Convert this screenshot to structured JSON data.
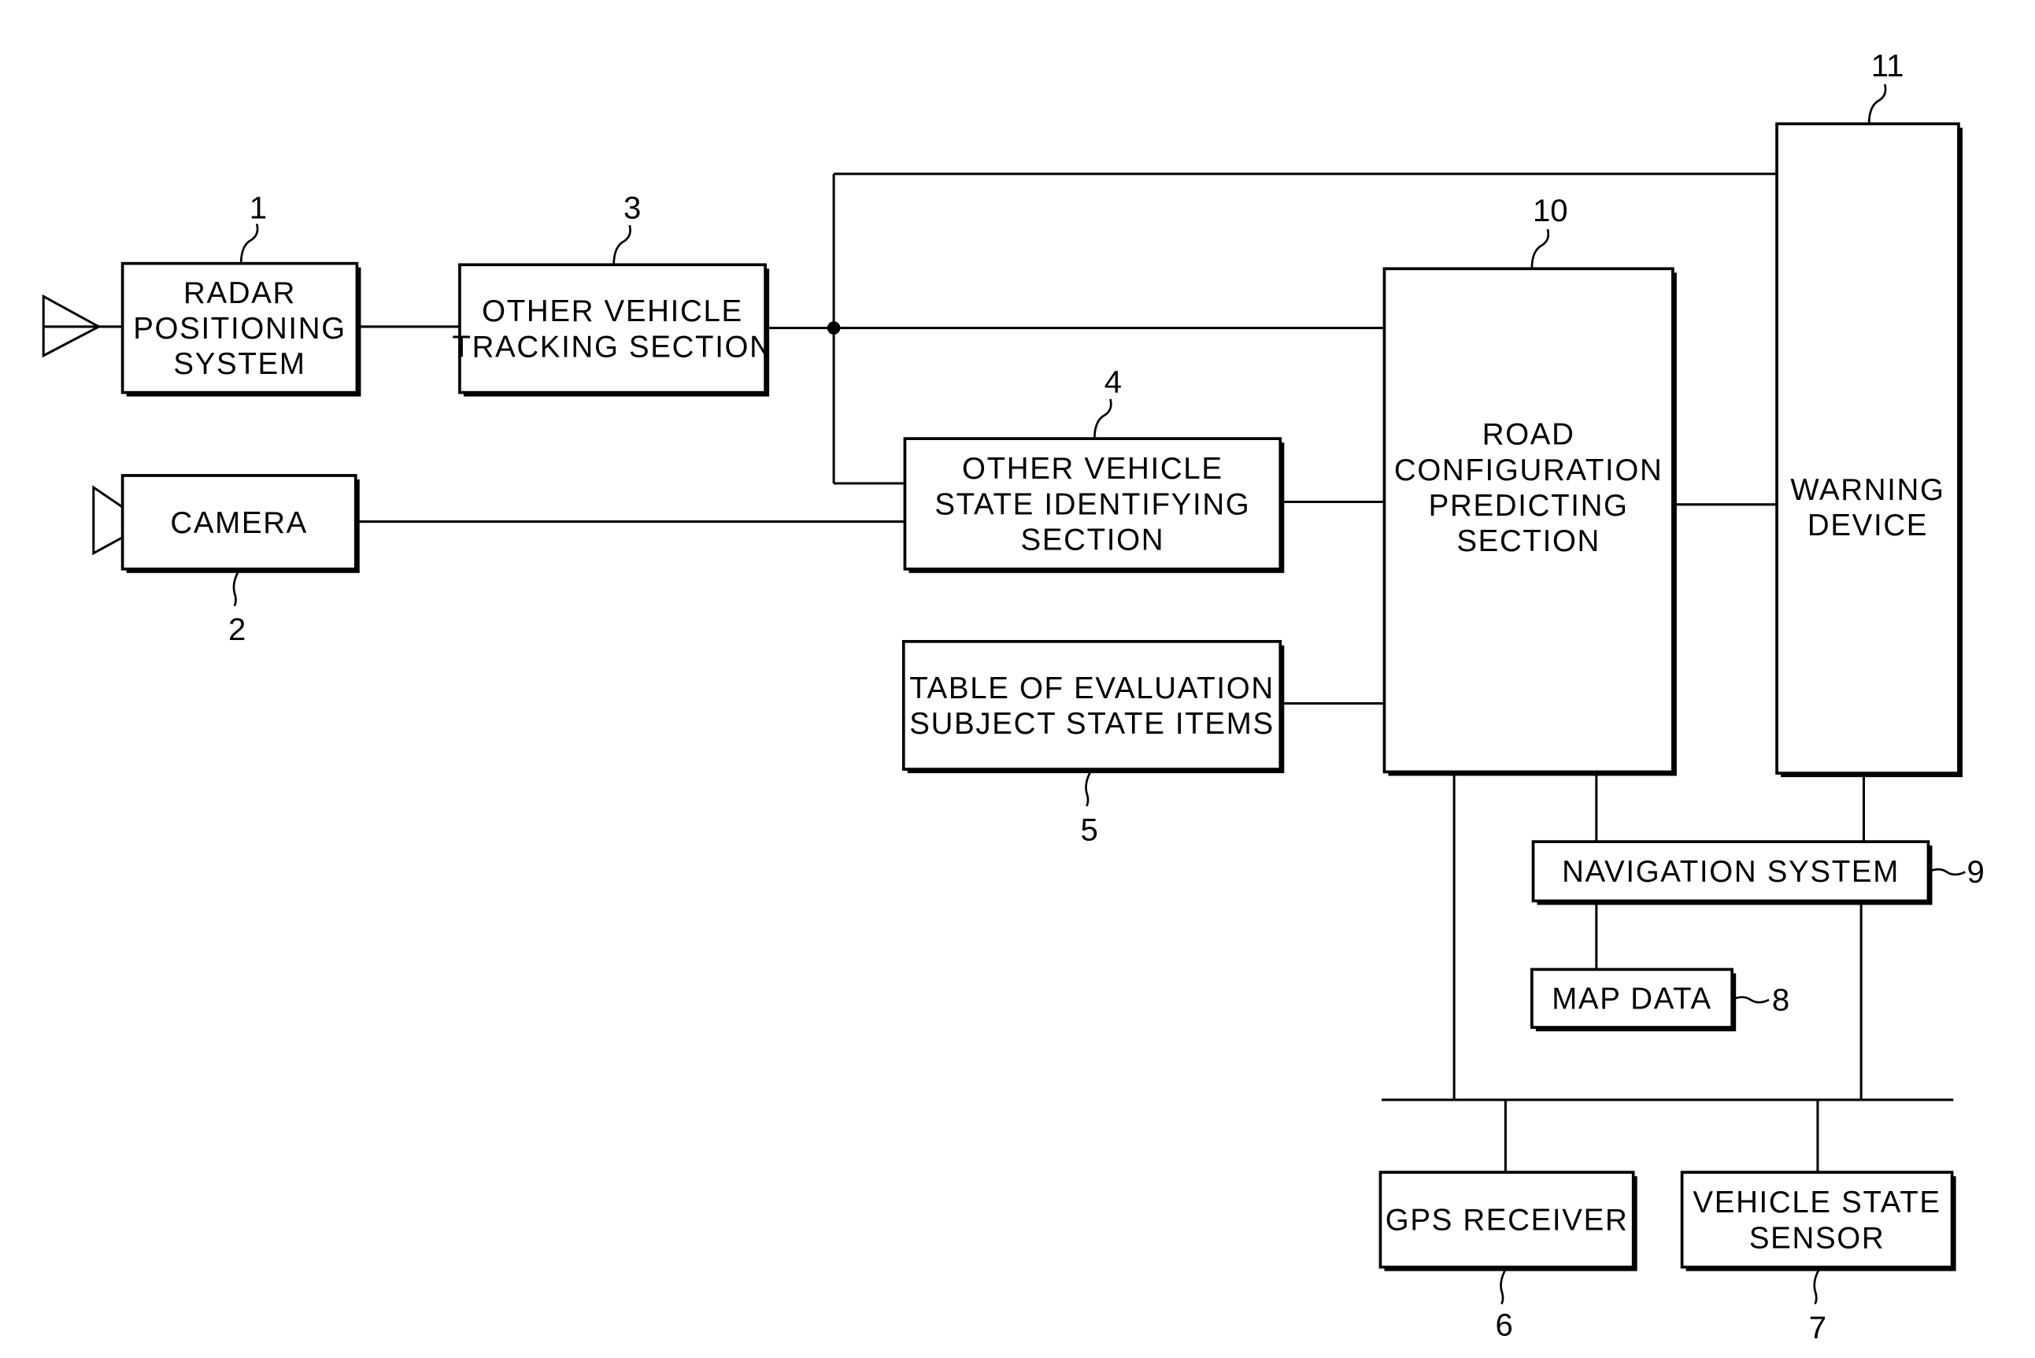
{
  "diagram": {
    "blocks": [
      {
        "id": "1",
        "ref": "1",
        "lines": [
          "RADAR",
          "POSITIONING",
          "SYSTEM"
        ]
      },
      {
        "id": "2",
        "ref": "2",
        "lines": [
          "CAMERA"
        ]
      },
      {
        "id": "3",
        "ref": "3",
        "lines": [
          "OTHER VEHICLE",
          "TRACKING SECTION"
        ]
      },
      {
        "id": "4",
        "ref": "4",
        "lines": [
          "OTHER VEHICLE",
          "STATE IDENTIFYING",
          "SECTION"
        ]
      },
      {
        "id": "5",
        "ref": "5",
        "lines": [
          "TABLE OF EVALUATION",
          "SUBJECT STATE ITEMS"
        ]
      },
      {
        "id": "6",
        "ref": "6",
        "lines": [
          "GPS RECEIVER"
        ]
      },
      {
        "id": "7",
        "ref": "7",
        "lines": [
          "VEHICLE STATE",
          "SENSOR"
        ]
      },
      {
        "id": "8",
        "ref": "8",
        "lines": [
          "MAP DATA"
        ]
      },
      {
        "id": "9",
        "ref": "9",
        "lines": [
          "NAVIGATION SYSTEM"
        ]
      },
      {
        "id": "10",
        "ref": "10",
        "lines": [
          "ROAD",
          "CONFIGURATION",
          "PREDICTING",
          "SECTION"
        ]
      },
      {
        "id": "11",
        "ref": "11",
        "lines": [
          "WARNING",
          "DEVICE"
        ]
      }
    ],
    "connections": [
      [
        "1",
        "3"
      ],
      [
        "2",
        "4"
      ],
      [
        "3",
        "10"
      ],
      [
        "3",
        "4"
      ],
      [
        "3",
        "11"
      ],
      [
        "4",
        "10"
      ],
      [
        "5",
        "10"
      ],
      [
        "10",
        "11"
      ],
      [
        "10",
        "9"
      ],
      [
        "11",
        "9"
      ],
      [
        "9",
        "8"
      ],
      [
        "10",
        "bus"
      ],
      [
        "9",
        "bus"
      ],
      [
        "bus",
        "6"
      ],
      [
        "bus",
        "7"
      ]
    ]
  }
}
